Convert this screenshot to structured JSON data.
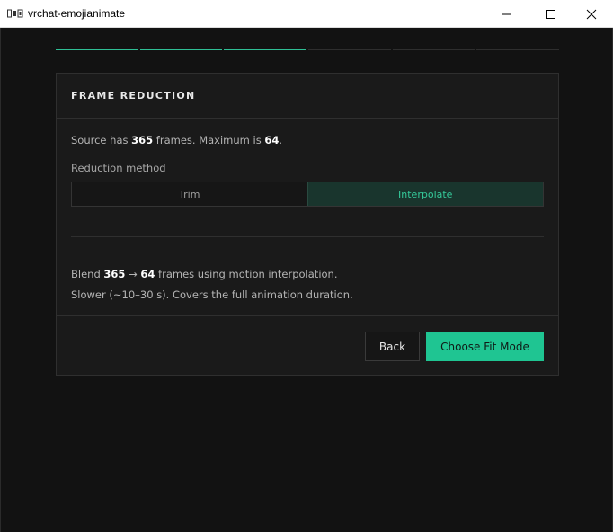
{
  "window": {
    "title": "vrchat-emojianimate",
    "icon": "app-icon",
    "controls": [
      "minimize-icon",
      "maximize-icon",
      "close-icon"
    ]
  },
  "progress": {
    "total_steps": 6,
    "completed_steps": 3,
    "accent": "#2fbf95"
  },
  "card": {
    "title": "FRAME REDUCTION",
    "source": {
      "prefix": "Source has ",
      "frames": "365",
      "middle": " frames. Maximum is ",
      "max": "64",
      "suffix": "."
    },
    "method_label": "Reduction method",
    "methods": [
      {
        "label": "Trim",
        "selected": false
      },
      {
        "label": "Interpolate",
        "selected": true
      }
    ],
    "description": {
      "prefix": "Blend ",
      "from": "365",
      "arrow": " → ",
      "to": "64",
      "suffix": " frames using motion interpolation.",
      "line2": "Slower (~10–30 s). Covers the full animation duration."
    },
    "buttons": {
      "back": "Back",
      "next": "Choose Fit Mode"
    }
  },
  "colors": {
    "background": "#121212",
    "card": "#1a1a1a",
    "accent": "#1fc592",
    "selected_bg": "#19352d",
    "selected_text": "#35c99a"
  }
}
